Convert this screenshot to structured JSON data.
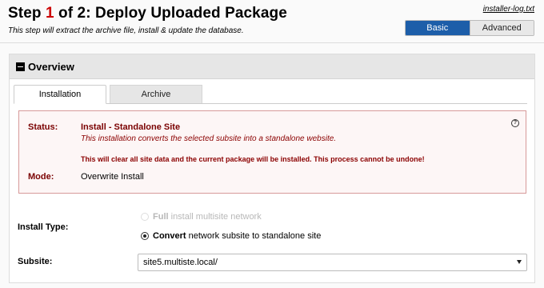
{
  "header": {
    "title_prefix": "Step",
    "step_number": "1",
    "title_suffix": "of 2: Deploy Uploaded Package",
    "subtitle": "This step will extract the archive file, install & update the database.",
    "log_link": "installer-log.txt",
    "mode_basic": "Basic",
    "mode_advanced": "Advanced"
  },
  "overview": {
    "title": "Overview",
    "tabs": [
      "Installation",
      "Archive"
    ],
    "status_label": "Status:",
    "status_value": "Install - Standalone Site",
    "status_desc": "This installation converts the selected subsite into a standalone website.",
    "warning": "This will clear all site data and the current package will be installed. This process cannot be undone!",
    "help_glyph": "?",
    "mode_label": "Mode:",
    "mode_value": "Overwrite Install"
  },
  "form": {
    "install_type_label": "Install Type:",
    "option_full_bold": "Full",
    "option_full_rest": "install multisite network",
    "option_convert_bold": "Convert",
    "option_convert_rest": "network subsite to standalone site",
    "subsite_label": "Subsite:",
    "subsite_value": "site5.multiste.local/"
  },
  "colors": {
    "accent_blue": "#1d5ea9",
    "status_red": "#7a0000",
    "step_red": "#cc0000"
  }
}
